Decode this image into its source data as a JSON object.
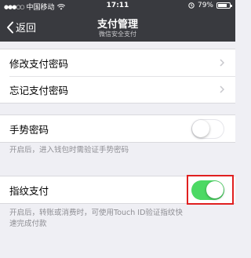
{
  "status_bar": {
    "carrier": "中国移动",
    "time": "17:11",
    "battery": "79%",
    "battery_level": 0.79
  },
  "nav": {
    "back_label": "返回",
    "title": "支付管理",
    "subtitle": "微信安全支付"
  },
  "password_group": {
    "items": [
      {
        "label": "修改支付密码"
      },
      {
        "label": "忘记支付密码"
      }
    ]
  },
  "gesture": {
    "label": "手势密码",
    "enabled": false,
    "hint": "开启后，进入钱包时需验证手势密码"
  },
  "fingerprint": {
    "label": "指纹支付",
    "enabled": true,
    "hint_line1": "开启后，转账或消费时，可使用Touch ID验证指纹快",
    "hint_line2": "速完成付款"
  },
  "colors": {
    "nav_bg": "#393a3f",
    "toggle_on": "#4cd964",
    "highlight": "#e02020"
  }
}
